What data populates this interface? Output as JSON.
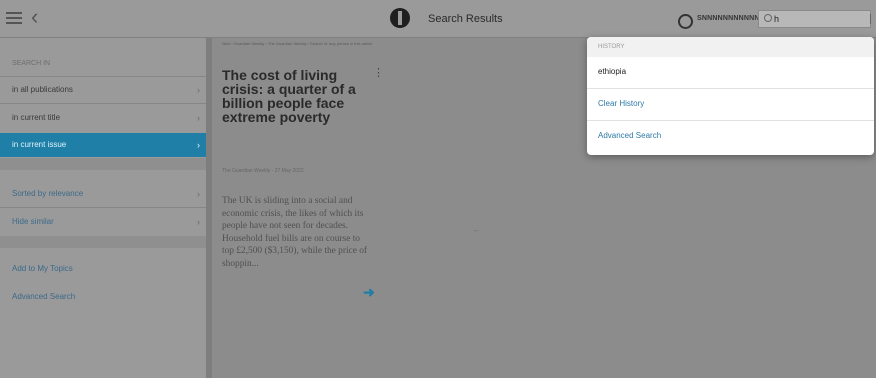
{
  "header": {
    "title": "Search Results",
    "account_label": "SNNNNNNNNNNN"
  },
  "search": {
    "value": "h"
  },
  "sidebar": {
    "section_label": "SEARCH IN",
    "scope_items": [
      {
        "label": "in all publications"
      },
      {
        "label": "in current title"
      },
      {
        "label": "in current issue",
        "active": true
      }
    ],
    "sort_items": [
      {
        "label": "Sorted by relevance"
      },
      {
        "label": "Hide similar"
      }
    ],
    "actions": [
      {
        "label": "Add to My Topics"
      },
      {
        "label": "Advanced Search"
      }
    ]
  },
  "article": {
    "breadcrumb": "Next › Guardian Weekly › The Guardian Weekly › Search in: any phrase in this article",
    "headline": "The cost of living crisis: a quarter of a billion people face extreme poverty",
    "meta": "The Guardian Weekly · 27 May 2022",
    "excerpt": "The UK is sliding into a social and economic crisis, the likes of which its people have not seen for decades. Household fuel bills are on course to top £2,500 ($3,150), while the price of shoppin..."
  },
  "dropdown": {
    "history_label": "HISTORY",
    "history_items": [
      "ethiopia"
    ],
    "clear_label": "Clear History",
    "advanced_label": "Advanced Search"
  },
  "icons": {
    "menu": "hamburger-menu-icon",
    "back": "chevron-left-icon",
    "logo": "publisher-logo-icon",
    "account": "user-circle-icon",
    "search": "search-icon",
    "more": "more-vertical-icon",
    "next": "arrow-right-icon"
  },
  "colors": {
    "accent": "#1f7fa6",
    "link": "#2d7aa6"
  }
}
